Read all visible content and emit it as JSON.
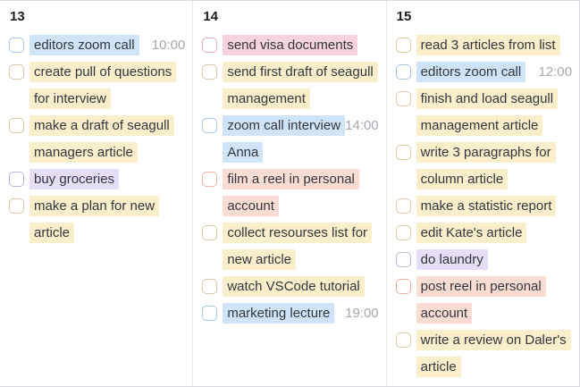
{
  "board": {
    "columns": [
      {
        "day": "13",
        "tasks": [
          {
            "text": "editors zoom call",
            "color": "blue",
            "time": "10:00"
          },
          {
            "text": "create pull of questions for interview",
            "color": "yellow"
          },
          {
            "text": "make a draft of seagull managers article",
            "color": "yellow"
          },
          {
            "text": "buy groceries",
            "color": "purple"
          },
          {
            "text": "make a plan for new article",
            "color": "yellow"
          }
        ]
      },
      {
        "day": "14",
        "tasks": [
          {
            "text": "send visa documents",
            "color": "pink"
          },
          {
            "text": "send first draft of seagull management",
            "color": "yellow"
          },
          {
            "text": "zoom call interview Anna",
            "color": "blue",
            "time": "14:00"
          },
          {
            "text": "film a reel in personal account",
            "color": "salmon"
          },
          {
            "text": "collect resourses list for new article",
            "color": "yellow"
          },
          {
            "text": "watch VSCode tutorial",
            "color": "yellow"
          },
          {
            "text": "marketing lecture",
            "color": "blue",
            "time": "19:00"
          }
        ]
      },
      {
        "day": "15",
        "tasks": [
          {
            "text": "read 3 articles from list",
            "color": "yellow"
          },
          {
            "text": "editors zoom call",
            "color": "blue",
            "time": "12:00"
          },
          {
            "text": "finish and load seagull management article",
            "color": "yellow"
          },
          {
            "text": "write 3 paragraphs for column article",
            "color": "yellow"
          },
          {
            "text": "make a statistic report",
            "color": "yellow"
          },
          {
            "text": "edit Kate's article",
            "color": "yellow"
          },
          {
            "text": "do laundry",
            "color": "purple"
          },
          {
            "text": "post reel in personal account",
            "color": "salmon"
          },
          {
            "text": "write a review on Daler's article",
            "color": "yellow"
          }
        ]
      }
    ]
  },
  "colors": {
    "blue": {
      "bg": "#cfe3f9",
      "border": "#a6c6ec"
    },
    "yellow": {
      "bg": "#faeecb",
      "border": "#d9c9a0"
    },
    "purple": {
      "bg": "#e6def6",
      "border": "#c1b2e2"
    },
    "pink": {
      "bg": "#f8d2dd",
      "border": "#e5a8bf"
    },
    "salmon": {
      "bg": "#fadcd2",
      "border": "#ecb4a2"
    }
  },
  "checkbox_state": "unchecked"
}
